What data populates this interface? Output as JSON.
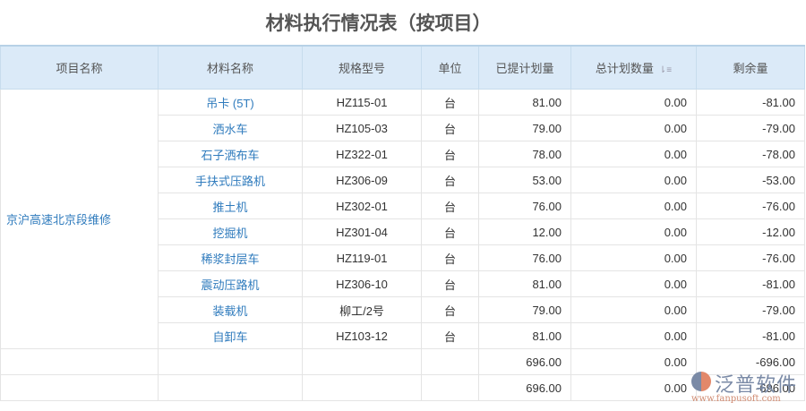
{
  "title": "材料执行情况表（按项目）",
  "headers": [
    "项目名称",
    "材料名称",
    "规格型号",
    "单位",
    "已提计划量",
    "总计划数量",
    "剩余量"
  ],
  "project": "京沪高速北京段维修",
  "rows": [
    [
      "吊卡 (5T)",
      "HZ115-01",
      "台",
      "81.00",
      "0.00",
      "-81.00"
    ],
    [
      "洒水车",
      "HZ105-03",
      "台",
      "79.00",
      "0.00",
      "-79.00"
    ],
    [
      "石子洒布车",
      "HZ322-01",
      "台",
      "78.00",
      "0.00",
      "-78.00"
    ],
    [
      "手扶式压路机",
      "HZ306-09",
      "台",
      "53.00",
      "0.00",
      "-53.00"
    ],
    [
      "推土机",
      "HZ302-01",
      "台",
      "76.00",
      "0.00",
      "-76.00"
    ],
    [
      "挖掘机",
      "HZ301-04",
      "台",
      "12.00",
      "0.00",
      "-12.00"
    ],
    [
      "稀浆封层车",
      "HZ119-01",
      "台",
      "76.00",
      "0.00",
      "-76.00"
    ],
    [
      "震动压路机",
      "HZ306-10",
      "台",
      "81.00",
      "0.00",
      "-81.00"
    ],
    [
      "装载机",
      "柳工/2号",
      "台",
      "79.00",
      "0.00",
      "-79.00"
    ],
    [
      "自卸车",
      "HZ103-12",
      "台",
      "81.00",
      "0.00",
      "-81.00"
    ]
  ],
  "totals": [
    [
      "696.00",
      "0.00",
      "-696.00"
    ],
    [
      "696.00",
      "0.00",
      "-696.00"
    ]
  ],
  "watermark": {
    "name": "泛普软件",
    "url": "www.fanpusoft.com"
  }
}
